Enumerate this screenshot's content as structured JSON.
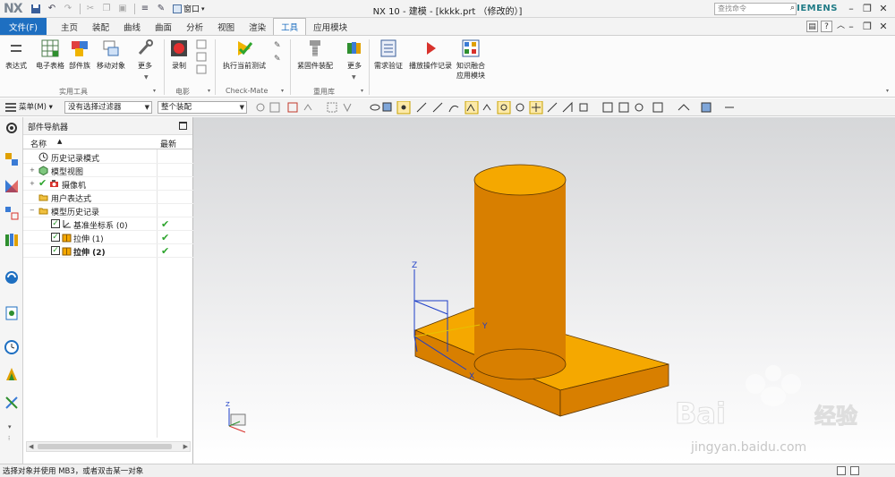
{
  "titlebar": {
    "logo": "NX",
    "window_menu": "窗口",
    "title": "NX 10 - 建模 - [kkkk.prt （修改的）]",
    "brand": "SIEMENS"
  },
  "menubar": {
    "file": "文件(F)",
    "tabs": [
      "主页",
      "装配",
      "曲线",
      "曲面",
      "分析",
      "视图",
      "渲染",
      "工具",
      "应用模块"
    ],
    "active_tab": "工具",
    "search_placeholder": "查找命令"
  },
  "ribbon": {
    "groups": {
      "utilities": "实用工具",
      "movie": "电影",
      "checkmate": "Check-Mate",
      "reuse": "重用库"
    },
    "buttons": {
      "expression": "表达式",
      "spreadsheet": "电子表格",
      "part_family": "部件族",
      "move_object": "移动对象",
      "more1": "更多",
      "record": "录制",
      "run_test": "执行当前测试",
      "fastener": "紧固件装配",
      "more2": "更多",
      "requirements": "需求验证",
      "playback": "播放操作记录",
      "kf_line1": "知识融合",
      "kf_line2": "应用模块"
    }
  },
  "selection_toolbar": {
    "menu": "菜单(M)",
    "filter": "没有选择过滤器",
    "scope": "整个装配"
  },
  "navigator": {
    "title": "部件导航器",
    "col_name": "名称",
    "col_latest": "最新",
    "rows": [
      {
        "label": "历史记录模式"
      },
      {
        "label": "模型视图"
      },
      {
        "label": "摄像机"
      },
      {
        "label": "用户表达式"
      },
      {
        "label": "模型历史记录"
      },
      {
        "label": "基准坐标系 (0)"
      },
      {
        "label": "拉伸 (1)"
      },
      {
        "label": "拉伸 (2)"
      }
    ]
  },
  "graphics": {
    "axis_z": "Z",
    "axis_y": "Y",
    "axis_x": "X",
    "watermark_text": "jingyan.baidu.com",
    "colors": {
      "body": "#f5a800",
      "side": "#d87f00",
      "edge": "#5a3500"
    }
  },
  "statusbar": {
    "message": "选择对象并使用 MB3，或者双击某一对象"
  }
}
